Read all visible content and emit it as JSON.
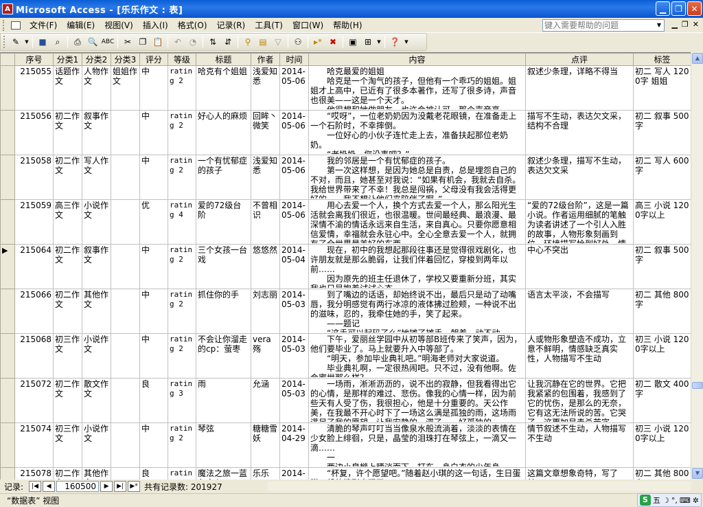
{
  "window": {
    "title": "Microsoft Access - [乐乐作文 : 表]",
    "app_icon": "access-key-icon"
  },
  "menubar": {
    "items": [
      "文件(F)",
      "编辑(E)",
      "视图(V)",
      "插入(I)",
      "格式(O)",
      "记录(R)",
      "工具(T)",
      "窗口(W)",
      "帮助(H)"
    ],
    "help_placeholder": "键入需要帮助的问题"
  },
  "table": {
    "columns": [
      "序号",
      "分类1",
      "分类2",
      "分类3",
      "评分",
      "等级",
      "标题",
      "作者",
      "时间",
      "内容",
      "点评",
      "标签"
    ],
    "rows": [
      {
        "id": "215055",
        "c1": "话题作文",
        "c2": "人物作文",
        "c3": "姐姐作文",
        "score": "中",
        "level": "rating 2",
        "title": "哈克有个姐姐",
        "author": "浅爱知悉",
        "time": "2014-05-06",
        "content": [
          "哈克最爱的姐姐",
          "哈克是一个淘气的孩子，但他有一个乖巧的姐姐。姐姐才上高中，已近有了很多本著作，还写了很多诗，声音也很美——这是一个天才。",
          "他很想和她做朋友，也许会被认可，那个声音高。"
        ],
        "comment": "叙述少条理，详略不得当",
        "tags": "初二 写人 1200字 姐姐"
      },
      {
        "id": "215056",
        "c1": "初二作文",
        "c2": "叙事作文",
        "c3": "",
        "score": "中",
        "level": "rating 2",
        "title": "好心人的麻烦",
        "author": "回眸丶微笑",
        "time": "2014-05-06",
        "content": [
          "“哎呀”，一位老奶奶因为没戴老花眼镜，在准备走上一个石阶时，不幸摔倒。",
          "一位好心的小伙子连忙走上去，准备扶起那位老奶奶。",
          "“老奶奶，您没事吧？”"
        ],
        "comment": "描写不生动，表达欠文采，结构不合理",
        "tags": "初二 叙事 500字"
      },
      {
        "id": "215058",
        "c1": "初二作文",
        "c2": "写人作文",
        "c3": "",
        "score": "中",
        "level": "rating 2",
        "title": "一个有忧郁症的孩子",
        "author": "浅爱知悉",
        "time": "2014-05-06",
        "content": [
          "我的邻居是一个有忧郁症的孩子。",
          "第一次这样想，是因为她总是自责，总是埋怨自己的不对，而且，她甚至对我说：“如果有机会，我就去自杀。我给世界带来了不幸！我总是闯祸，父母没有我会活得更好的……我不想让他们来陪伴了啊。”"
        ],
        "comment": "叙述少条理，描写不生动，表达欠文采",
        "tags": "初二 写人 600字"
      },
      {
        "id": "215059",
        "c1": "高三作文",
        "c2": "小说作文",
        "c3": "",
        "score": "优",
        "level": "rating 4",
        "title": "爱的72级台阶",
        "author": "不曾相识",
        "time": "2014-05-06",
        "content": [
          "用心去爱一个人，换个方式去爱一个人，那么阳光生活就会离我们很近，也很温暖。世间最经典、最浪漫、最深情不渝的情话永远来自生活，来自真心。只要你愿意相信爱情，幸福就会永驻心中。全心全意去爱一个人，就拥有了全世界最美好的东西。"
        ],
        "comment": "“爱的72级台阶”，这是一篇小说。作者运用细腻的笔触为读者讲述了一个引人入胜的故事，人物形象刻画到位，环境描写恰到好处，情节……",
        "tags": "高三 小说 1200字以上"
      },
      {
        "id": "215064",
        "c1": "初二作文",
        "c2": "叙事作文",
        "c3": "",
        "score": "中",
        "level": "rating 2",
        "title": "三个女孩一台戏",
        "author": "悠悠然",
        "time": "2014-05-04",
        "content": [
          "现在，初中的我想起那段往事还是觉得很戏剧化，也许朋友就是那么脆弱，让我们伴着回忆，穿梭到两年以前……",
          "因为原先的班主任退休了，学校又要重新分班，其实我也只是抱着试试心态……"
        ],
        "comment": "中心不突出",
        "tags": "初二 叙事 500字"
      },
      {
        "id": "215066",
        "c1": "初二作文",
        "c2": "其他作文",
        "c3": "",
        "score": "中",
        "level": "rating 2",
        "title": "抓住你的手",
        "author": "刘志丽",
        "time": "2014-05-03",
        "content": [
          "到了嘴边的话语，却始终说不出，最后只是动了动嘴唇，我分明感觉有两行冰凉的液体拂过脸颊，一种说不出的滋味，忍的，我牵住她的手，笑了起来。",
          "——题记",
          "“这手可以起码了么”她摊了摊手，朝着一动不动。"
        ],
        "comment": "语言太平淡，不会描写",
        "tags": "初二 其他 800字"
      },
      {
        "id": "215068",
        "c1": "初三作文",
        "c2": "小说作文",
        "c3": "",
        "score": "中",
        "level": "rating 2",
        "title": "不会让你溜走的cp：萤枣",
        "author": "vera殇",
        "time": "2014-05-03",
        "content": [
          "下午，爱丽丝学园中从初等部B班传来了笑声，因为，他们要毕业了。马上就要升入中等部了。",
          "“明天，参加毕业典礼吧。”明海老师对大家说道。",
          "毕业典礼啊，一定很热闹吧。只不过，没有他啊。佐会蜜世那么样？"
        ],
        "comment": "人或物形象塑造不成功，立意不鲜明，情感缺乏真实性，人物描写不生动",
        "tags": "初三 小说 1200字以上"
      },
      {
        "id": "215072",
        "c1": "初二作文",
        "c2": "散文作文",
        "c3": "",
        "score": "良",
        "level": "rating 3",
        "title": "雨",
        "author": "允涵",
        "time": "2014-05-03",
        "content": [
          "一场雨，淅淅沥沥的，说不出的寂静，但我看得出它的心情，是那样的难过、悲伤。像我的心情一样，因为前些天有人受了伤，我很担心，他是十分重要的。天公作美，在我最不开心时下了一场这么满是孤独的雨，这场雨满足了我的愿望，让我安静的一滞了……好孤独的……"
        ],
        "comment": "让我沉静在它的世界。它把我紧紧的包围着，我感到了它的忧伤，是那么的无奈，它有这无法所说的苦。它哭了，这更加是毒杀苦字是……",
        "tags": "初二 散文 400字"
      },
      {
        "id": "215074",
        "c1": "初三作文",
        "c2": "小说作文",
        "c3": "",
        "score": "中",
        "level": "rating 2",
        "title": "琴弦",
        "author": "糖糖雪妖",
        "time": "2014-04-29",
        "content": [
          "清脆的琴声叮叮当当像泉水般流淌着，淡淡的表情在少女脸上绯徊，只是，晶莹的泪珠打在琴弦上，一滴又一滴……",
          "一",
          "两边小皇橼上晒淡而下，打东，身白衣的少年身上……"
        ],
        "comment": "情节叙述不生动，人物描写不生动",
        "tags": "初三 小说 1200字以上"
      },
      {
        "id": "215078",
        "c1": "初二作文",
        "c2": "其他作文",
        "c3": "",
        "score": "良",
        "level": "rating 2",
        "title": "魔法之旅一蓝色之心",
        "author": "乐乐",
        "time": "2014-04-29",
        "content": [
          "“杯复，许个愿望吧。”随着赵小琪的这一句话，生日蛋糕一般的情形出现了……"
        ],
        "comment": "这篇文章想象奇特，写了林……",
        "tags": "初二 其他 800字"
      }
    ],
    "current_row_index": 4
  },
  "navigation": {
    "label": "记录:",
    "current_record": "160500",
    "total_label": "共有记录数: 201927"
  },
  "statusbar": {
    "text": "“数据表” 视图"
  },
  "ime": {
    "logo": "S",
    "mode": "五"
  }
}
